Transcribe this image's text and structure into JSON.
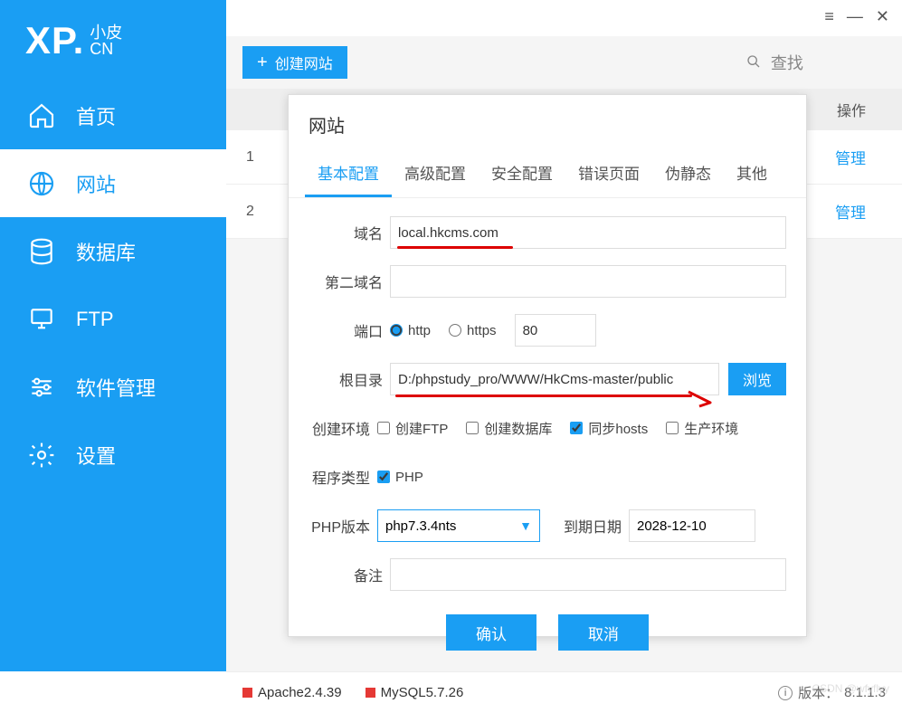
{
  "logo": {
    "xp": "XP.",
    "small": "小皮",
    "cn": "CN"
  },
  "sidebar": {
    "items": [
      {
        "label": "首页"
      },
      {
        "label": "网站"
      },
      {
        "label": "数据库"
      },
      {
        "label": "FTP"
      },
      {
        "label": "软件管理"
      },
      {
        "label": "设置"
      }
    ]
  },
  "toolbar": {
    "create_label": "创建网站",
    "search_label": "查找"
  },
  "table": {
    "header_op": "操作",
    "rows": [
      {
        "num": "1",
        "manage": "管理"
      },
      {
        "num": "2",
        "manage": "管理"
      }
    ]
  },
  "modal": {
    "title": "网站",
    "tabs": [
      "基本配置",
      "高级配置",
      "安全配置",
      "错误页面",
      "伪静态",
      "其他"
    ],
    "labels": {
      "domain": "域名",
      "domain2": "第二域名",
      "port": "端口",
      "root": "根目录",
      "env": "创建环境",
      "ptype": "程序类型",
      "phpver": "PHP版本",
      "expire": "到期日期",
      "note": "备注"
    },
    "values": {
      "domain": "local.hkcms.com",
      "domain2": "",
      "port": "80",
      "root": "D:/phpstudy_pro/WWW/HkCms-master/public",
      "phpver": "php7.3.4nts",
      "expire": "2028-12-10",
      "note": ""
    },
    "radios": {
      "http": "http",
      "https": "https"
    },
    "checks": {
      "ftp": "创建FTP",
      "db": "创建数据库",
      "hosts": "同步hosts",
      "prod": "生产环境",
      "php": "PHP"
    },
    "browse": "浏览",
    "confirm": "确认",
    "cancel": "取消"
  },
  "status": {
    "apache": "Apache2.4.39",
    "mysql": "MySQL5.7.26",
    "version_label": "版本：",
    "version": "8.1.1.3"
  },
  "watermark": "CSDN @wfyflyy"
}
